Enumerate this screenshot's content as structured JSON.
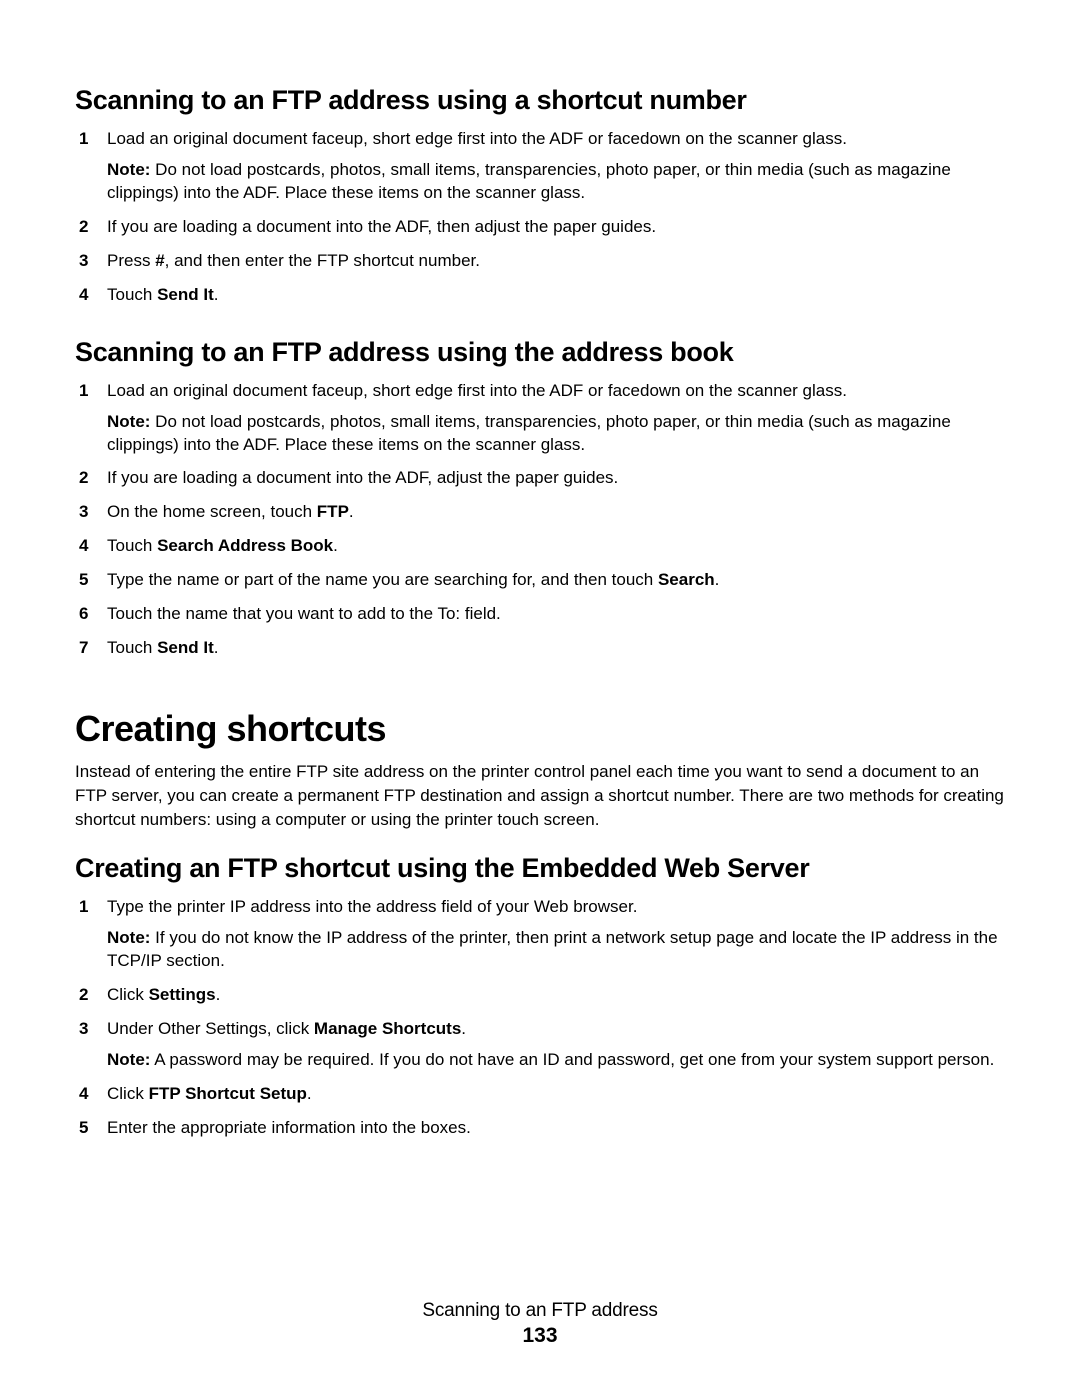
{
  "section1": {
    "heading": "Scanning to an FTP address using a shortcut number",
    "steps": [
      {
        "text": "Load an original document faceup, short edge first into the ADF or facedown on the scanner glass.",
        "note_label": "Note:",
        "note": " Do not load postcards, photos, small items, transparencies, photo paper, or thin media (such as magazine clippings) into the ADF. Place these items on the scanner glass."
      },
      {
        "text": "If you are loading a document into the ADF, then adjust the paper guides."
      },
      {
        "pre": "Press ",
        "bold": "#",
        "post": ", and then enter the FTP shortcut number."
      },
      {
        "pre": "Touch ",
        "bold": "Send It",
        "post": "."
      }
    ]
  },
  "section2": {
    "heading": "Scanning to an FTP address using the address book",
    "steps": [
      {
        "text": "Load an original document faceup, short edge first into the ADF or facedown on the scanner glass.",
        "note_label": "Note:",
        "note": " Do not load postcards, photos, small items, transparencies, photo paper, or thin media (such as magazine clippings) into the ADF. Place these items on the scanner glass."
      },
      {
        "text": "If you are loading a document into the ADF, adjust the paper guides."
      },
      {
        "pre": "On the home screen, touch ",
        "bold": "FTP",
        "post": "."
      },
      {
        "pre": "Touch ",
        "bold": "Search Address Book",
        "post": "."
      },
      {
        "pre": "Type the name or part of the name you are searching for, and then touch ",
        "bold": "Search",
        "post": "."
      },
      {
        "text": "Touch the name that you want to add to the To: field."
      },
      {
        "pre": "Touch ",
        "bold": "Send It",
        "post": "."
      }
    ]
  },
  "main_heading": "Creating shortcuts",
  "intro": "Instead of entering the entire FTP site address on the printer control panel each time you want to send a document to an FTP server, you can create a permanent FTP destination and assign a shortcut number. There are two methods for creating shortcut numbers: using a computer or using the printer touch screen.",
  "section3": {
    "heading": "Creating an FTP shortcut using the Embedded Web Server",
    "steps": [
      {
        "text": "Type the printer IP address into the address field of your Web browser.",
        "note_label": "Note:",
        "note": " If you do not know the IP address of the printer, then print a network setup page and locate the IP address in the TCP/IP section."
      },
      {
        "pre": "Click ",
        "bold": "Settings",
        "post": "."
      },
      {
        "pre": "Under Other Settings, click ",
        "bold": "Manage Shortcuts",
        "post": ".",
        "note_label": "Note:",
        "note": " A password may be required. If you do not have an ID and password, get one from your system support person."
      },
      {
        "pre": "Click ",
        "bold": "FTP Shortcut Setup",
        "post": "."
      },
      {
        "text": "Enter the appropriate information into the boxes."
      }
    ]
  },
  "footer": {
    "title": "Scanning to an FTP address",
    "page": "133"
  }
}
